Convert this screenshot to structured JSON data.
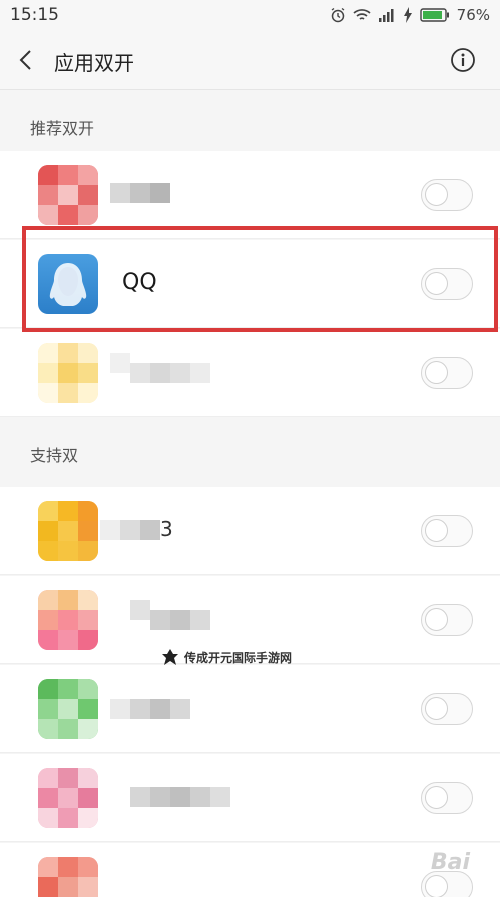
{
  "status_bar": {
    "time": "15:15",
    "battery_percent": "76%"
  },
  "title_bar": {
    "title": "应用双开"
  },
  "sections": {
    "recommended_label": "推荐双开",
    "supported_label": "支持双"
  },
  "apps": {
    "qq_name": "QQ",
    "supported_first_partial": "3"
  },
  "toggles": [
    {
      "state": "off"
    },
    {
      "state": "off"
    },
    {
      "state": "off"
    },
    {
      "state": "off"
    },
    {
      "state": "off"
    },
    {
      "state": "off"
    },
    {
      "state": "off"
    },
    {
      "state": "off"
    }
  ],
  "watermark": {
    "text": "传成开元国际手游网",
    "corner": "Bai"
  },
  "colors": {
    "highlight": "#d93a3a",
    "qq_blue": "#3a8fd8"
  }
}
